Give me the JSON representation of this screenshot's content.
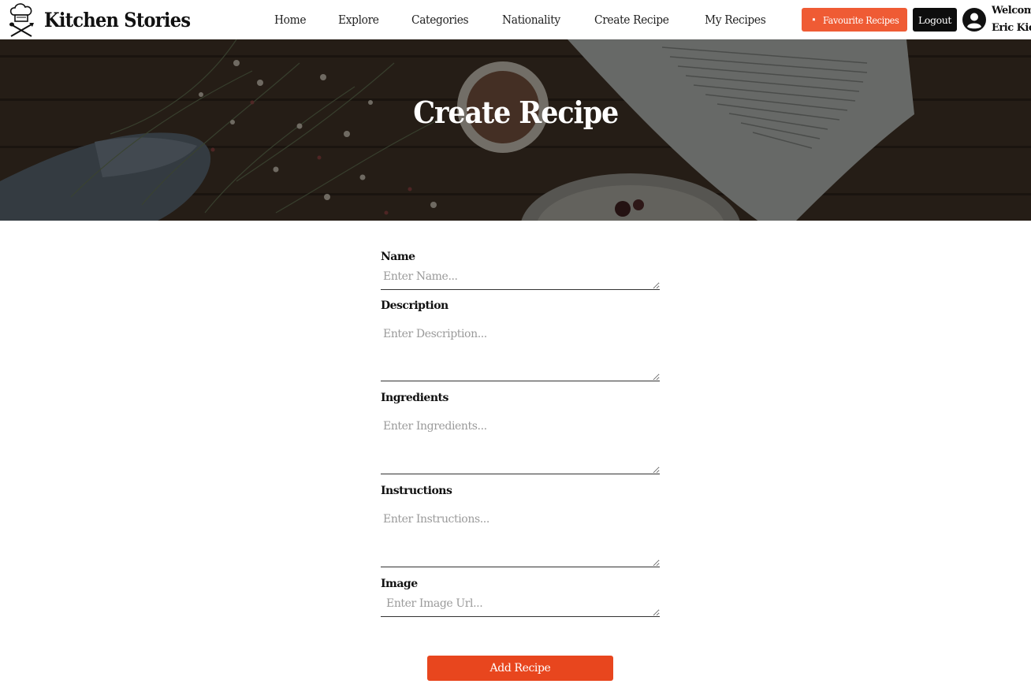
{
  "brand": {
    "name": "Kitchen Stories",
    "logo_icon": "chef-hat-utensils-icon"
  },
  "nav": {
    "links": [
      {
        "label": "Home"
      },
      {
        "label": "Explore"
      },
      {
        "label": "Categories"
      },
      {
        "label": "Nationality"
      },
      {
        "label": "Create Recipe"
      },
      {
        "label": "My Recipes"
      }
    ]
  },
  "header_actions": {
    "favourites_label": "Favourite Recipes",
    "favourites_icon": "bookmark-icon",
    "logout_label": "Logout",
    "avatar_icon": "user-circle-icon",
    "welcome_line1": "Welcome",
    "welcome_line2": "Eric Kiok"
  },
  "hero": {
    "title": "Create Recipe"
  },
  "form": {
    "name": {
      "label": "Name",
      "placeholder": "Enter Name...",
      "value": ""
    },
    "description": {
      "label": "Description",
      "placeholder": "Enter Description...",
      "value": ""
    },
    "ingredients": {
      "label": "Ingredients",
      "placeholder": "Enter Ingredients...",
      "value": ""
    },
    "instructions": {
      "label": "Instructions",
      "placeholder": "Enter Instructions...",
      "value": ""
    },
    "image": {
      "label": "Image",
      "placeholder": "Enter Image Url...",
      "value": ""
    },
    "submit_label": "Add Recipe"
  },
  "colors": {
    "accent": "#ef5b34",
    "submit": "#e8461e",
    "dark": "#0d0d0d"
  }
}
